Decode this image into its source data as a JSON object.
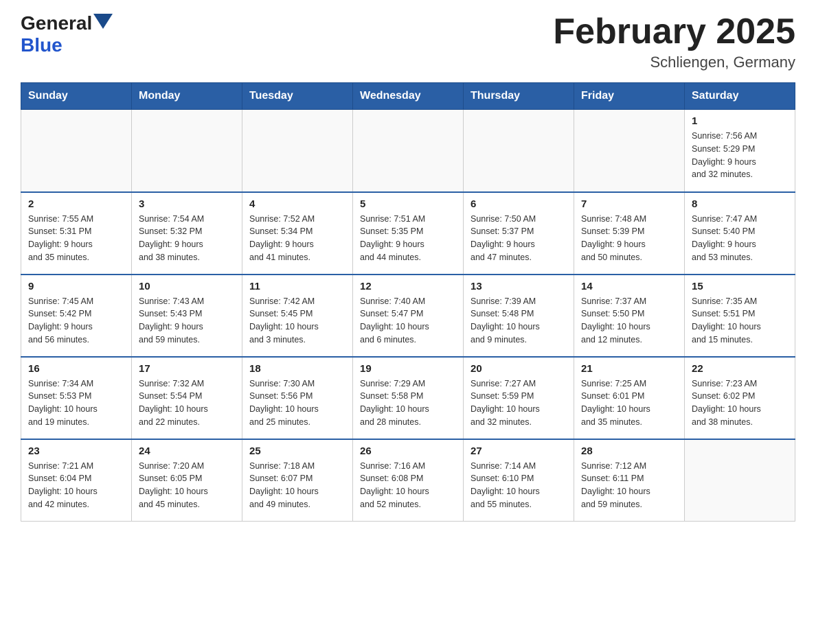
{
  "header": {
    "logo_general": "General",
    "logo_blue": "Blue",
    "month_title": "February 2025",
    "location": "Schliengen, Germany"
  },
  "days_of_week": [
    "Sunday",
    "Monday",
    "Tuesday",
    "Wednesday",
    "Thursday",
    "Friday",
    "Saturday"
  ],
  "weeks": [
    [
      {
        "day": "",
        "info": ""
      },
      {
        "day": "",
        "info": ""
      },
      {
        "day": "",
        "info": ""
      },
      {
        "day": "",
        "info": ""
      },
      {
        "day": "",
        "info": ""
      },
      {
        "day": "",
        "info": ""
      },
      {
        "day": "1",
        "info": "Sunrise: 7:56 AM\nSunset: 5:29 PM\nDaylight: 9 hours\nand 32 minutes."
      }
    ],
    [
      {
        "day": "2",
        "info": "Sunrise: 7:55 AM\nSunset: 5:31 PM\nDaylight: 9 hours\nand 35 minutes."
      },
      {
        "day": "3",
        "info": "Sunrise: 7:54 AM\nSunset: 5:32 PM\nDaylight: 9 hours\nand 38 minutes."
      },
      {
        "day": "4",
        "info": "Sunrise: 7:52 AM\nSunset: 5:34 PM\nDaylight: 9 hours\nand 41 minutes."
      },
      {
        "day": "5",
        "info": "Sunrise: 7:51 AM\nSunset: 5:35 PM\nDaylight: 9 hours\nand 44 minutes."
      },
      {
        "day": "6",
        "info": "Sunrise: 7:50 AM\nSunset: 5:37 PM\nDaylight: 9 hours\nand 47 minutes."
      },
      {
        "day": "7",
        "info": "Sunrise: 7:48 AM\nSunset: 5:39 PM\nDaylight: 9 hours\nand 50 minutes."
      },
      {
        "day": "8",
        "info": "Sunrise: 7:47 AM\nSunset: 5:40 PM\nDaylight: 9 hours\nand 53 minutes."
      }
    ],
    [
      {
        "day": "9",
        "info": "Sunrise: 7:45 AM\nSunset: 5:42 PM\nDaylight: 9 hours\nand 56 minutes."
      },
      {
        "day": "10",
        "info": "Sunrise: 7:43 AM\nSunset: 5:43 PM\nDaylight: 9 hours\nand 59 minutes."
      },
      {
        "day": "11",
        "info": "Sunrise: 7:42 AM\nSunset: 5:45 PM\nDaylight: 10 hours\nand 3 minutes."
      },
      {
        "day": "12",
        "info": "Sunrise: 7:40 AM\nSunset: 5:47 PM\nDaylight: 10 hours\nand 6 minutes."
      },
      {
        "day": "13",
        "info": "Sunrise: 7:39 AM\nSunset: 5:48 PM\nDaylight: 10 hours\nand 9 minutes."
      },
      {
        "day": "14",
        "info": "Sunrise: 7:37 AM\nSunset: 5:50 PM\nDaylight: 10 hours\nand 12 minutes."
      },
      {
        "day": "15",
        "info": "Sunrise: 7:35 AM\nSunset: 5:51 PM\nDaylight: 10 hours\nand 15 minutes."
      }
    ],
    [
      {
        "day": "16",
        "info": "Sunrise: 7:34 AM\nSunset: 5:53 PM\nDaylight: 10 hours\nand 19 minutes."
      },
      {
        "day": "17",
        "info": "Sunrise: 7:32 AM\nSunset: 5:54 PM\nDaylight: 10 hours\nand 22 minutes."
      },
      {
        "day": "18",
        "info": "Sunrise: 7:30 AM\nSunset: 5:56 PM\nDaylight: 10 hours\nand 25 minutes."
      },
      {
        "day": "19",
        "info": "Sunrise: 7:29 AM\nSunset: 5:58 PM\nDaylight: 10 hours\nand 28 minutes."
      },
      {
        "day": "20",
        "info": "Sunrise: 7:27 AM\nSunset: 5:59 PM\nDaylight: 10 hours\nand 32 minutes."
      },
      {
        "day": "21",
        "info": "Sunrise: 7:25 AM\nSunset: 6:01 PM\nDaylight: 10 hours\nand 35 minutes."
      },
      {
        "day": "22",
        "info": "Sunrise: 7:23 AM\nSunset: 6:02 PM\nDaylight: 10 hours\nand 38 minutes."
      }
    ],
    [
      {
        "day": "23",
        "info": "Sunrise: 7:21 AM\nSunset: 6:04 PM\nDaylight: 10 hours\nand 42 minutes."
      },
      {
        "day": "24",
        "info": "Sunrise: 7:20 AM\nSunset: 6:05 PM\nDaylight: 10 hours\nand 45 minutes."
      },
      {
        "day": "25",
        "info": "Sunrise: 7:18 AM\nSunset: 6:07 PM\nDaylight: 10 hours\nand 49 minutes."
      },
      {
        "day": "26",
        "info": "Sunrise: 7:16 AM\nSunset: 6:08 PM\nDaylight: 10 hours\nand 52 minutes."
      },
      {
        "day": "27",
        "info": "Sunrise: 7:14 AM\nSunset: 6:10 PM\nDaylight: 10 hours\nand 55 minutes."
      },
      {
        "day": "28",
        "info": "Sunrise: 7:12 AM\nSunset: 6:11 PM\nDaylight: 10 hours\nand 59 minutes."
      },
      {
        "day": "",
        "info": ""
      }
    ]
  ]
}
